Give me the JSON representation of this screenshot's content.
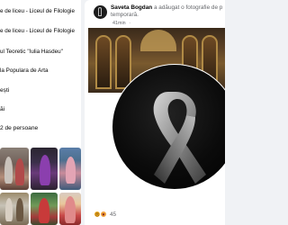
{
  "left_panel": {
    "rows": [
      {
        "text": "e de liceu - Liceul de Filologie",
        "bold": ""
      },
      {
        "text": "e de liceu - Liceul de Filologie",
        "bold": ""
      },
      {
        "text": "ul Teoretic \"Iulia Hasdeu\"",
        "bold": ""
      },
      {
        "text": "la Populara de Arta",
        "bold": ""
      },
      {
        "text": "ești",
        "bold": ""
      },
      {
        "text": "ăi",
        "bold": ""
      },
      {
        "text": "2 de persoane",
        "bold": ""
      }
    ]
  },
  "post": {
    "author": "Saveta Bogdan",
    "action": " a adăugat o fotografie de p temporară.",
    "time": "41min",
    "privacy_icon": "globe-icon",
    "reaction_icons": [
      "sad-icon",
      "care-icon"
    ],
    "reactions_count": "45",
    "colors": {
      "ribbon": "#9a9a9a",
      "background": "#000000",
      "link": "#65676b"
    }
  }
}
